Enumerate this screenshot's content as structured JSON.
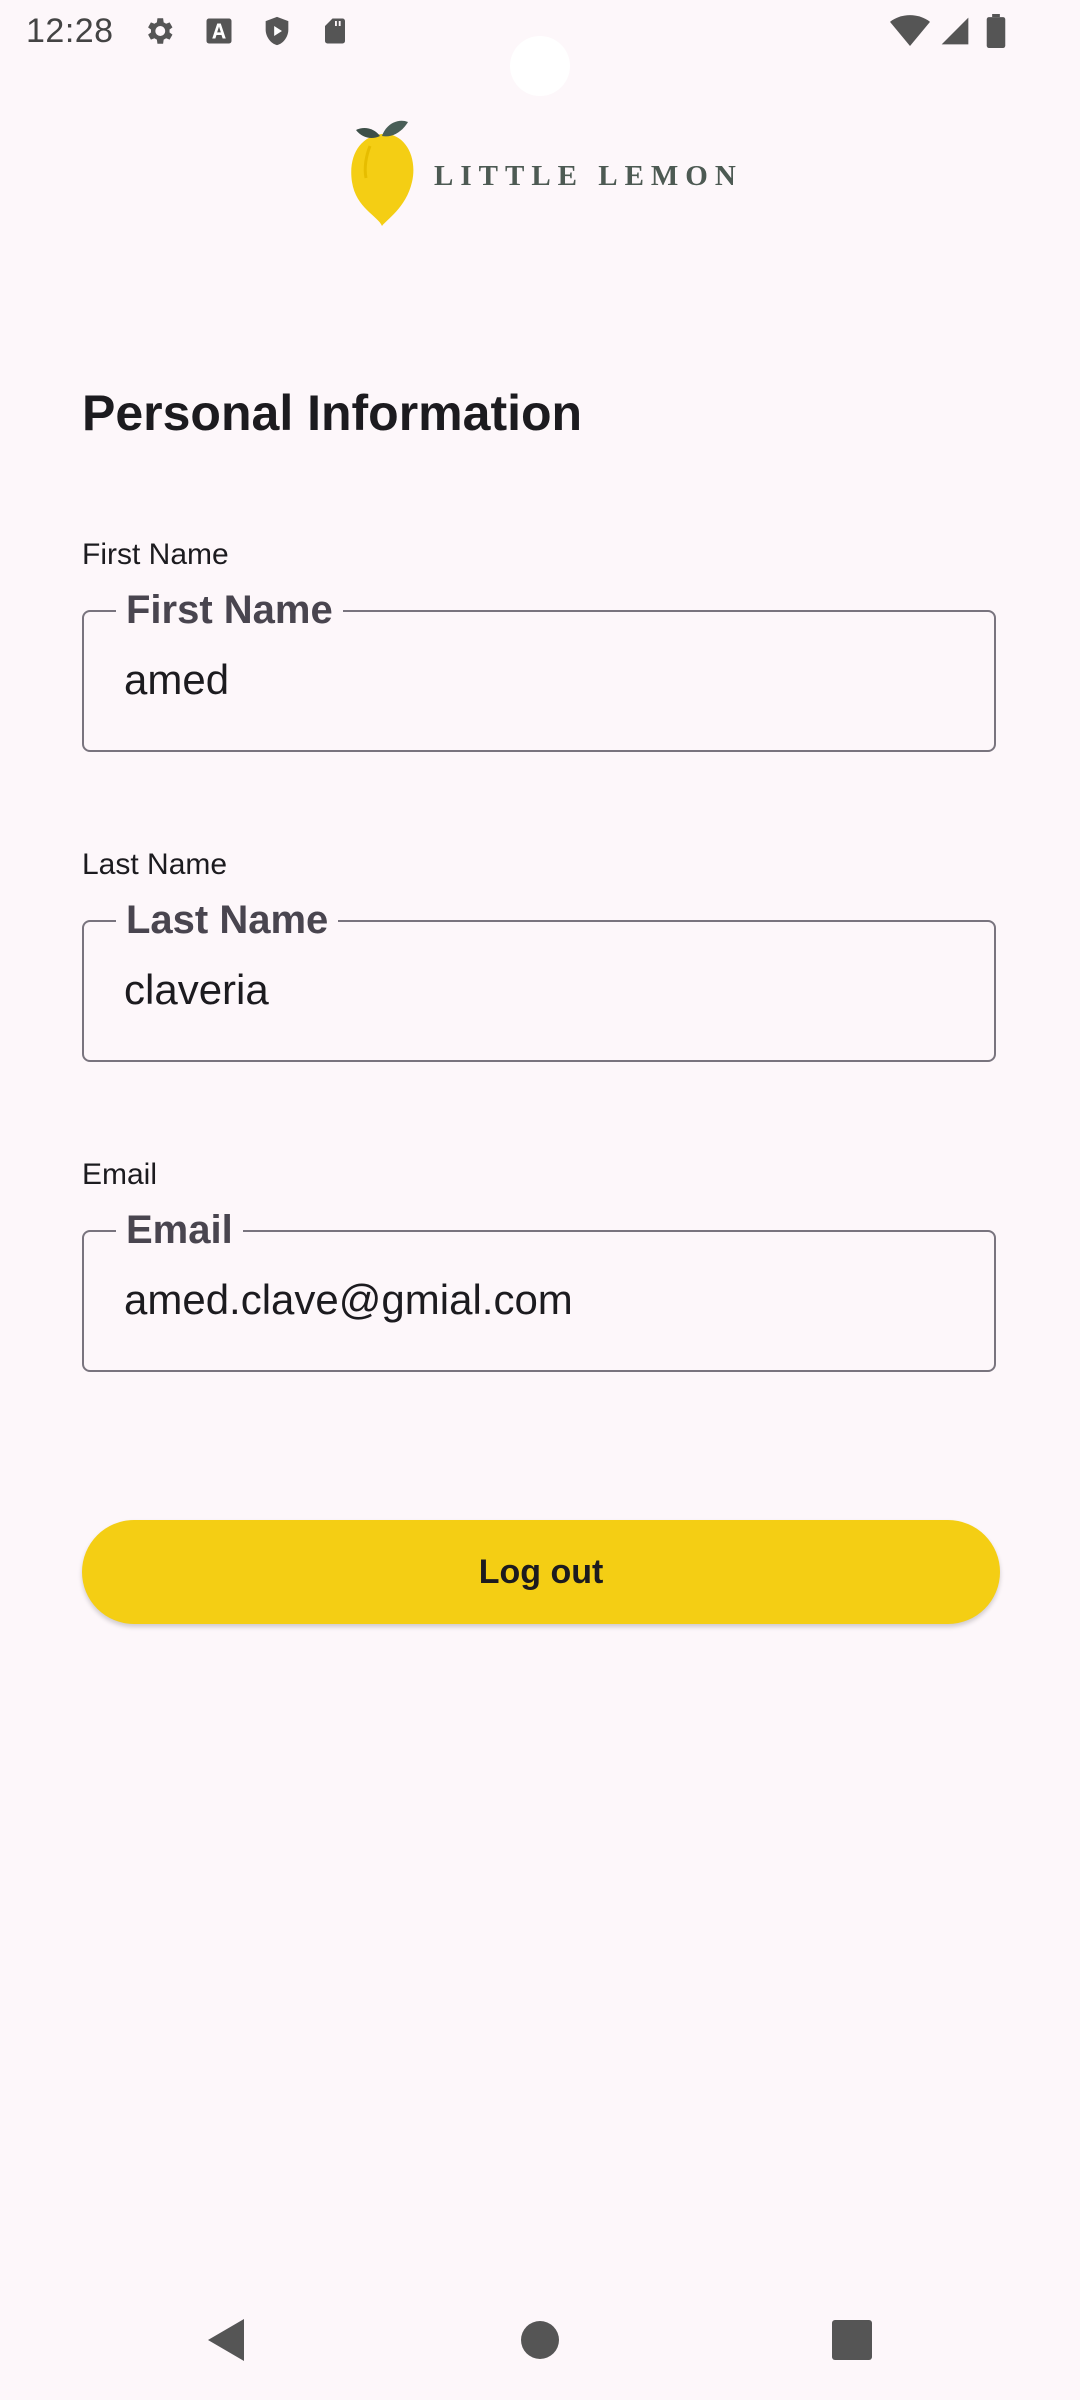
{
  "status_bar": {
    "time": "12:28",
    "left_icons": [
      "gear-icon",
      "font-a-icon",
      "shield-play-icon",
      "sd-card-icon"
    ],
    "right_icons": [
      "wifi-icon",
      "signal-icon",
      "battery-icon"
    ]
  },
  "logo": {
    "text": "LITTLE LEMON",
    "lemon_color": "#f4ce14",
    "leaf_color": "#495e57"
  },
  "page": {
    "title": "Personal Information"
  },
  "fields": {
    "first_name": {
      "caption": "First Name",
      "legend": "First Name",
      "value": "amed"
    },
    "last_name": {
      "caption": "Last Name",
      "legend": "Last Name",
      "value": "claveria"
    },
    "email": {
      "caption": "Email",
      "legend": "Email",
      "value": "amed.clave@gmial.com"
    }
  },
  "actions": {
    "logout_label": "Log out",
    "logout_color": "#f4ce14"
  },
  "nav_bar": {
    "icons": [
      "back-triangle-icon",
      "home-circle-icon",
      "recents-square-icon"
    ]
  }
}
